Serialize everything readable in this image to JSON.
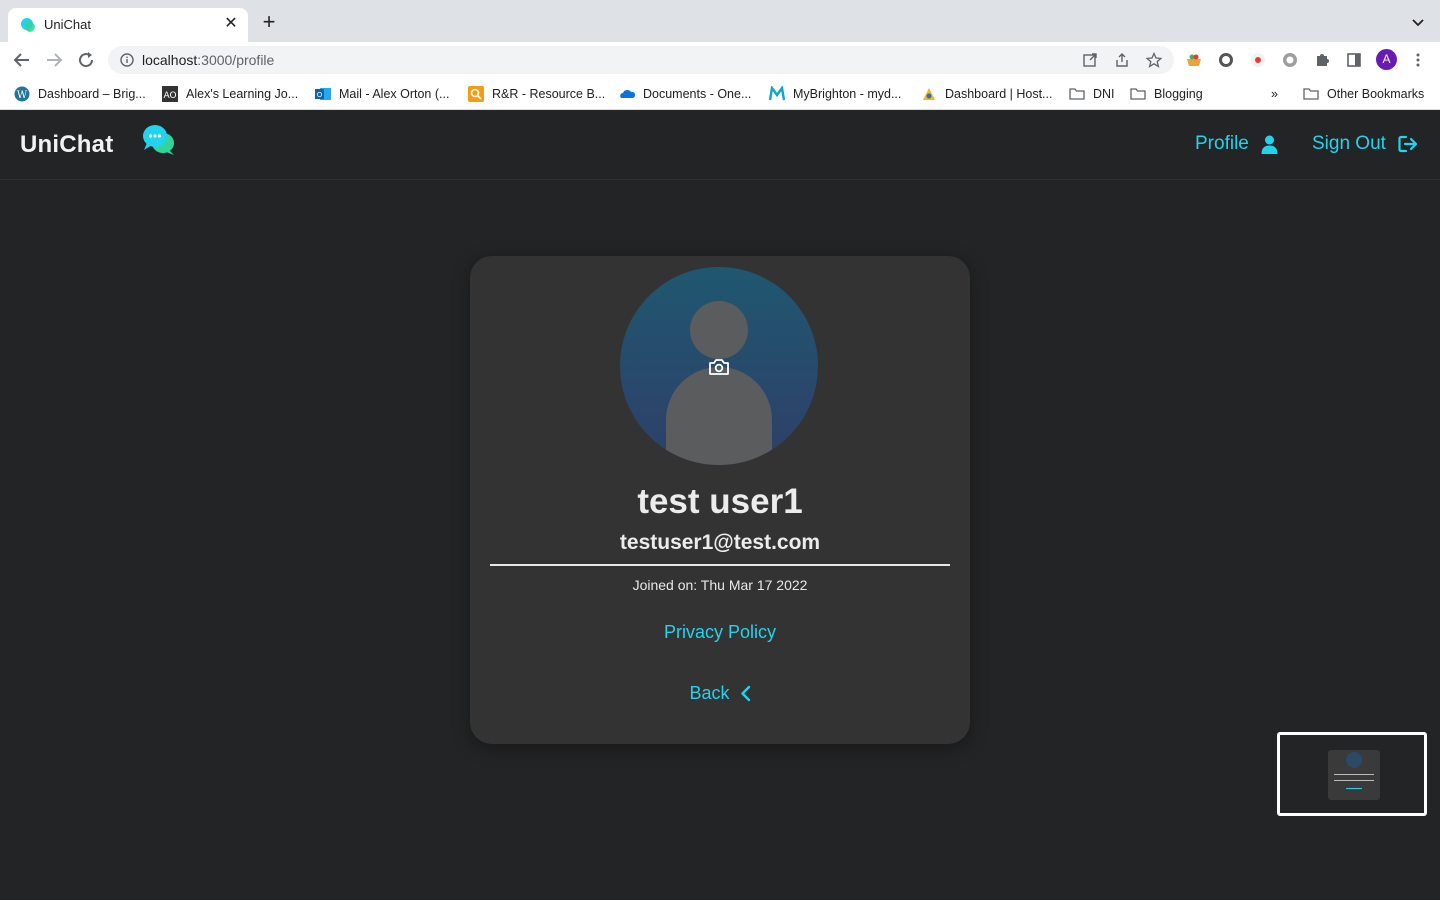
{
  "browser": {
    "tab_title": "UniChat",
    "url_host": "localhost",
    "url_path": ":3000/profile",
    "profile_initial": "A",
    "bookmarks": [
      {
        "label": "Dashboard – Brig...",
        "icon": "wordpress-icon"
      },
      {
        "label": "Alex's Learning Jo...",
        "icon": "ao-icon"
      },
      {
        "label": "Mail - Alex Orton (...",
        "icon": "outlook-icon"
      },
      {
        "label": "R&R - Resource B...",
        "icon": "search-orange-icon"
      },
      {
        "label": "Documents - One...",
        "icon": "onedrive-icon"
      },
      {
        "label": "MyBrighton - myd...",
        "icon": "m-logo-icon"
      },
      {
        "label": "Dashboard | Host...",
        "icon": "host-icon"
      },
      {
        "label": "DNI",
        "icon": "folder-icon"
      },
      {
        "label": "Blogging",
        "icon": "folder-icon"
      }
    ],
    "overflow_label": "»",
    "other_bookmarks": "Other Bookmarks"
  },
  "app": {
    "brand": "UniChat",
    "nav": {
      "profile_label": "Profile",
      "signout_label": "Sign Out"
    },
    "accent_color": "#22d3ee",
    "background_color": "#232425"
  },
  "profile": {
    "name": "test user1",
    "email": "testuser1@test.com",
    "joined": "Joined on: Thu Mar 17 2022",
    "privacy_label": "Privacy Policy",
    "back_label": "Back"
  }
}
